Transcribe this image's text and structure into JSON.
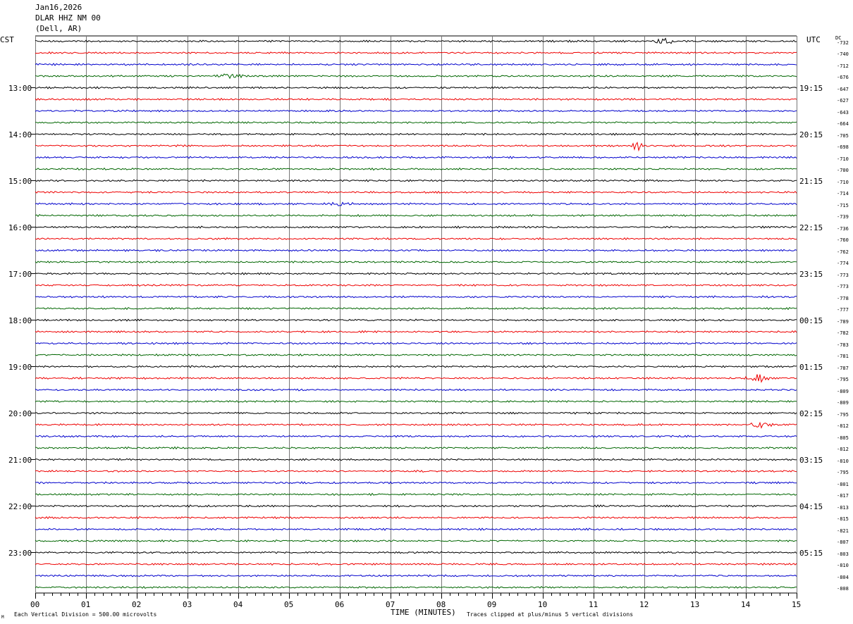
{
  "header": {
    "date": "Jan16,2026",
    "station": "DLAR HHZ NM 00",
    "location": "(Dell, AR)"
  },
  "left_tz": "CST",
  "right_tz": "UTC",
  "dc_label": "DC",
  "footer": {
    "scale": "Each Vertical Division =  500.00 microvolts",
    "clip": "Traces clipped at plus/minus 5 vertical divisions",
    "corner_mark": "M"
  },
  "chart_data": {
    "type": "line",
    "subtype": "seismogram-helicorder",
    "xlabel": "TIME (MINUTES)",
    "x_ticks": [
      "00",
      "01",
      "02",
      "03",
      "04",
      "05",
      "06",
      "07",
      "08",
      "09",
      "10",
      "11",
      "12",
      "13",
      "14",
      "15"
    ],
    "xlim": [
      0,
      15
    ],
    "grid": true,
    "trace_colors": [
      "#000000",
      "#ee0000",
      "#0000cc",
      "#006600"
    ],
    "left_time_labels": [
      "13:00",
      "14:00",
      "15:00",
      "16:00",
      "17:00",
      "18:00",
      "19:00",
      "20:00",
      "21:00",
      "22:00",
      "23:00"
    ],
    "right_time_labels": [
      "19:15",
      "20:15",
      "21:15",
      "22:15",
      "23:15",
      "00:15",
      "01:15",
      "02:15",
      "03:15",
      "04:15",
      "05:15"
    ],
    "dc_offsets": [
      "-732",
      "-740",
      "-712",
      "-676",
      "-647",
      "-627",
      "-643",
      "-664",
      "-705",
      "-698",
      "-710",
      "-700",
      "-710",
      "-714",
      "-715",
      "-739",
      "-736",
      "-760",
      "-762",
      "-774",
      "-773",
      "-773",
      "-778",
      "-777",
      "-789",
      "-782",
      "-783",
      "-781",
      "-787",
      "-795",
      "-809",
      "-809",
      "-795",
      "-812",
      "-805",
      "-812",
      "-810",
      "-795",
      "-801",
      "-817",
      "-813",
      "-815",
      "-821",
      "-807",
      "-803",
      "-810",
      "-804",
      "-808"
    ],
    "events": [
      {
        "trace": 9,
        "minute": 11.85,
        "amplitude": "large"
      },
      {
        "trace": 0,
        "minute": 12.4,
        "amplitude": "medium"
      },
      {
        "trace": 29,
        "minute": 14.3,
        "amplitude": "medium"
      },
      {
        "trace": 33,
        "minute": 14.3,
        "amplitude": "medium"
      },
      {
        "trace": 3,
        "minute": 3.8,
        "amplitude": "small"
      },
      {
        "trace": 14,
        "minute": 6.0,
        "amplitude": "small"
      }
    ]
  }
}
